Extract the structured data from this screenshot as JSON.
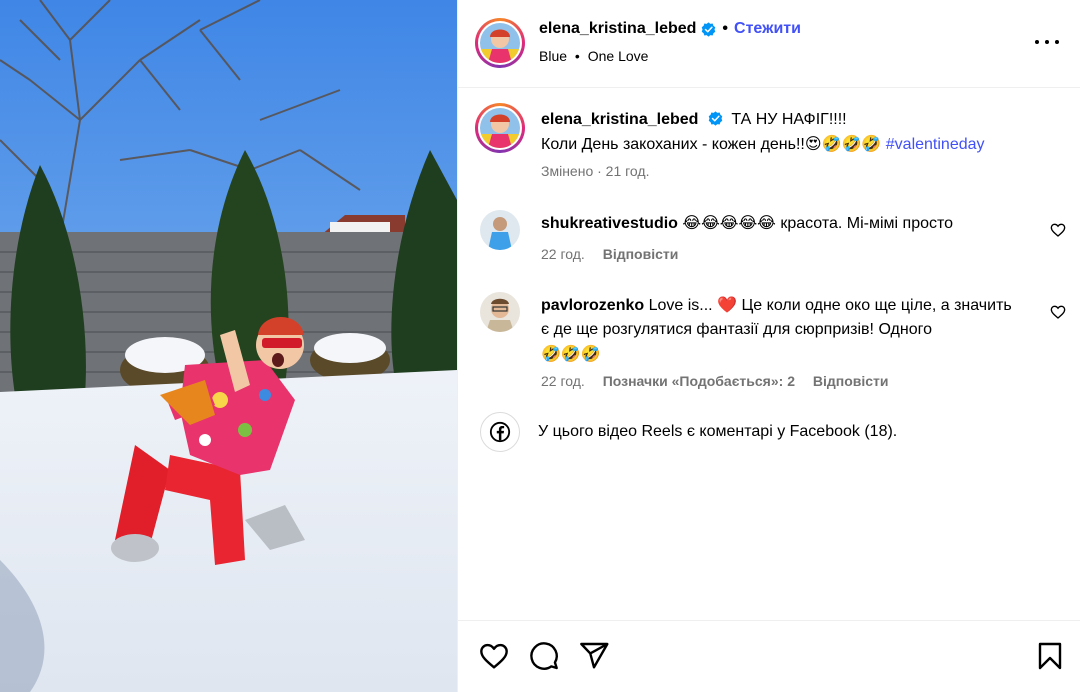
{
  "header": {
    "username": "elena_kristina_lebed",
    "follow_label": "Стежити",
    "separator": "•",
    "audio_artist": "Blue",
    "audio_sep": "•",
    "audio_track": "One Love"
  },
  "caption": {
    "username": "elena_kristina_lebed",
    "line1": "ТА НУ НАФІГ!!!!",
    "line2": "Коли День закоханих - кожен день!!",
    "emojis": "😍🤣🤣🤣",
    "hashtag": "#valentineday",
    "meta": "Змінено · 21 год."
  },
  "comments": [
    {
      "username": "shukreativestudio",
      "emojis": "😂😂😂😂😂",
      "text": "красота. Мі-мімі просто",
      "time": "22 год.",
      "reply_label": "Відповісти"
    },
    {
      "username": "pavlorozenko",
      "text_before": "Love is...",
      "heart": "❤️",
      "text_after": "Це коли одне око ще ціле, а значить є де ще розгулятися фантазії для сюрпризів! Одного",
      "emojis": "🤣🤣🤣",
      "time": "22 год.",
      "likes_label": "Позначки «Подобається»: 2",
      "reply_label": "Відповісти"
    }
  ],
  "facebook_note": "У цього відео Reels є коментарі у Facebook (18).",
  "icons": {
    "verified": "verified-badge-icon",
    "more": "more-options-icon",
    "like": "heart-icon",
    "comment": "comment-icon",
    "share": "share-icon",
    "save": "bookmark-icon",
    "facebook": "facebook-icon"
  },
  "colors": {
    "link": "#4150f7",
    "muted": "#737373",
    "verified": "#0095f6"
  }
}
